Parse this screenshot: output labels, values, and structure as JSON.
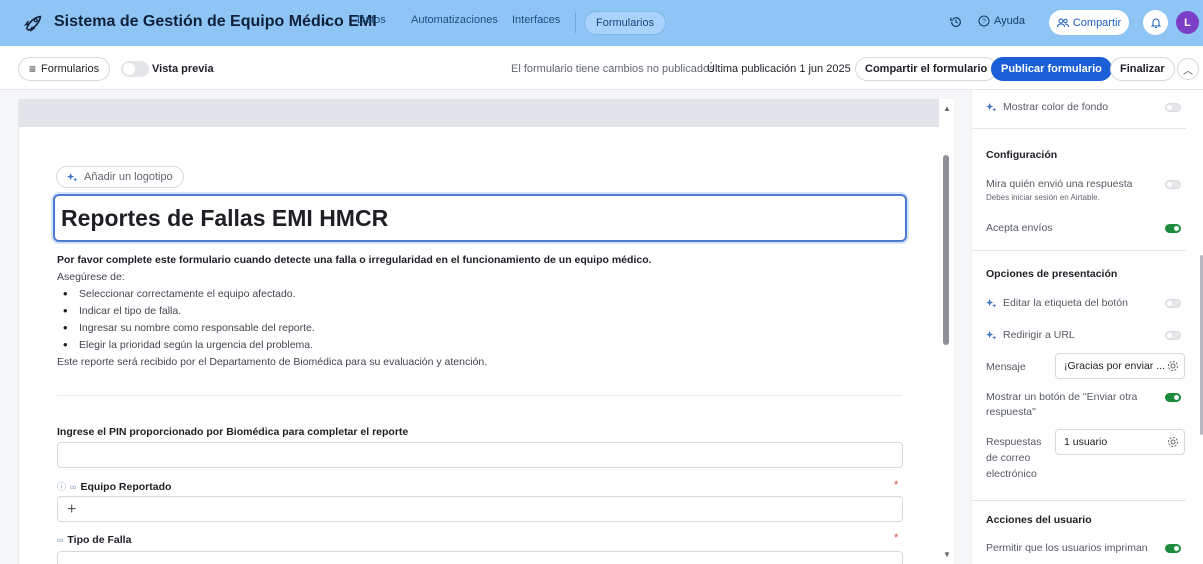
{
  "topbar": {
    "title": "Sistema de Gestión de Equipo Médico EMI",
    "nav": [
      "Datos",
      "Automatizaciones",
      "Interfaces",
      "Formularios"
    ],
    "help": "Ayuda",
    "share": "Compartir",
    "avatar_initial": "L",
    "colors": {
      "bar": "#8ec5f5",
      "avatar": "#7b3fc6"
    }
  },
  "toolbar": {
    "forms": "Formularios",
    "preview": "Vista previa",
    "unpublished": "El formulario tiene cambios no publicados",
    "last_published": "Última publicación 1 jun 2025",
    "share_form": "Compartir el formulario",
    "publish": "Publicar formulario",
    "finish": "Finalizar",
    "colors": {
      "publish": "#1b5fd6"
    }
  },
  "form": {
    "add_logo": "Añadir un logotipo",
    "title": "Reportes de Fallas EMI HMCR",
    "description_bold": "Por favor complete este formulario cuando detecte una falla o irregularidad en el funcionamiento de un equipo médico.",
    "ensure": "Asegúrese de:",
    "bullets": [
      "Seleccionar correctamente el equipo afectado.",
      "Indicar el tipo de falla.",
      "Ingresar su nombre como responsable del reporte.",
      "Elegir la prioridad según la urgencia del problema."
    ],
    "footer": "Este reporte será recibido por el Departamento de Biomédica para su evaluación y atención.",
    "fields": [
      {
        "label": "Ingrese el PIN proporcionado por Biomédica para completar el reporte"
      },
      {
        "label": "Equipo Reportado",
        "required": "*"
      },
      {
        "label": "Tipo de Falla",
        "required": "*"
      }
    ]
  },
  "panel": {
    "bg_color": "Mostrar color de fondo",
    "config_head": "Configuración",
    "who_sent": "Mira quién envió una respuesta",
    "login_note": "Debes iniciar sesión en Airtable.",
    "accepts": "Acepta envíos",
    "presentation_head": "Opciones de presentación",
    "edit_button_label": "Editar la etiqueta del botón",
    "redirect": "Redirigir a URL",
    "message_label": "Mensaje",
    "message_value": "¡Gracias por enviar ...",
    "show_another_line1": "Mostrar un botón de \"Enviar otra",
    "show_another_line2": "respuesta\"",
    "email_label_1": "Respuestas",
    "email_label_2": "de correo",
    "email_label_3": "electrónico",
    "email_value": "1 usuario",
    "user_actions_head": "Acciones del usuario",
    "allow_print": "Permitir que los usuarios impriman",
    "colors": {
      "toggle_on": "#1b8a3a"
    }
  }
}
